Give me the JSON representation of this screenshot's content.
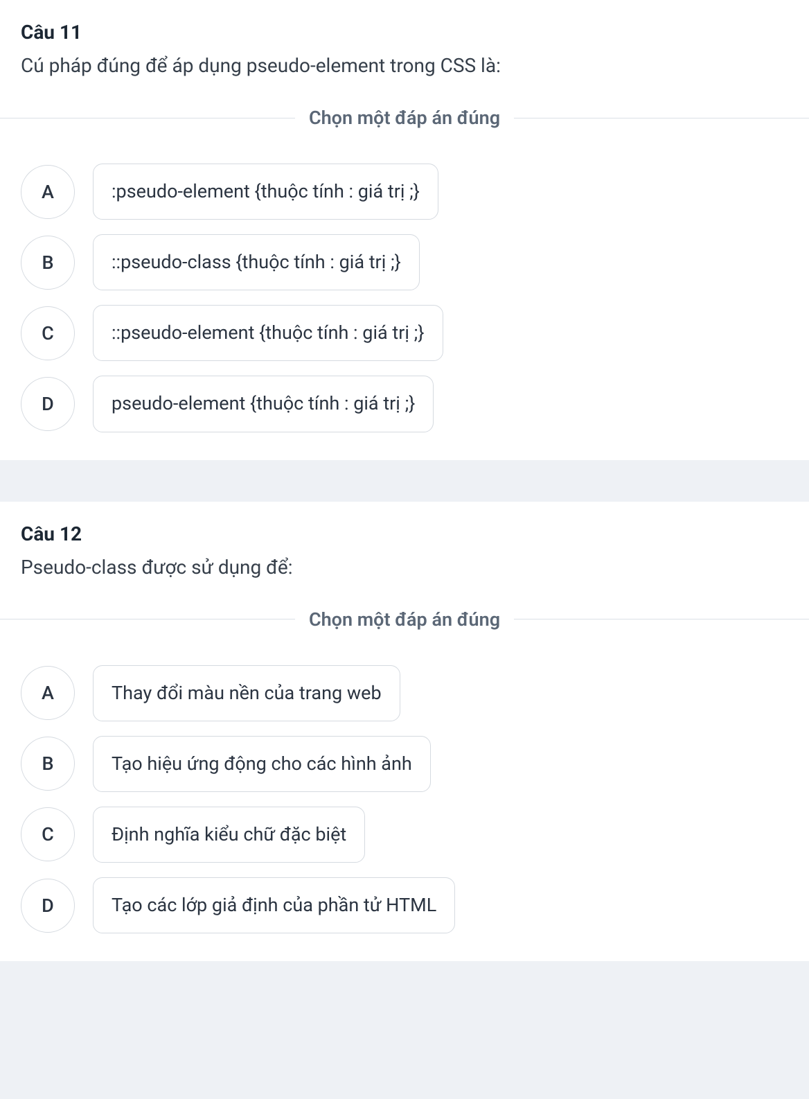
{
  "questions": [
    {
      "number": "Câu 11",
      "text": "Cú pháp đúng để áp dụng pseudo-element trong CSS là:",
      "instruction": "Chọn một đáp án đúng",
      "options": [
        {
          "letter": "A",
          "text": ":pseudo-element {thuộc tính : giá trị ;}"
        },
        {
          "letter": "B",
          "text": "::pseudo-class {thuộc tính : giá trị ;}"
        },
        {
          "letter": "C",
          "text": "::pseudo-element {thuộc tính : giá trị ;}"
        },
        {
          "letter": "D",
          "text": "pseudo-element {thuộc tính : giá trị ;}"
        }
      ]
    },
    {
      "number": "Câu 12",
      "text": "Pseudo-class được sử dụng để:",
      "instruction": "Chọn một đáp án đúng",
      "options": [
        {
          "letter": "A",
          "text": "Thay đổi màu nền của trang web"
        },
        {
          "letter": "B",
          "text": "Tạo hiệu ứng động cho các hình ảnh"
        },
        {
          "letter": "C",
          "text": "Định nghĩa kiểu chữ đặc biệt"
        },
        {
          "letter": "D",
          "text": "Tạo các lớp giả định của phần tử HTML"
        }
      ]
    }
  ]
}
